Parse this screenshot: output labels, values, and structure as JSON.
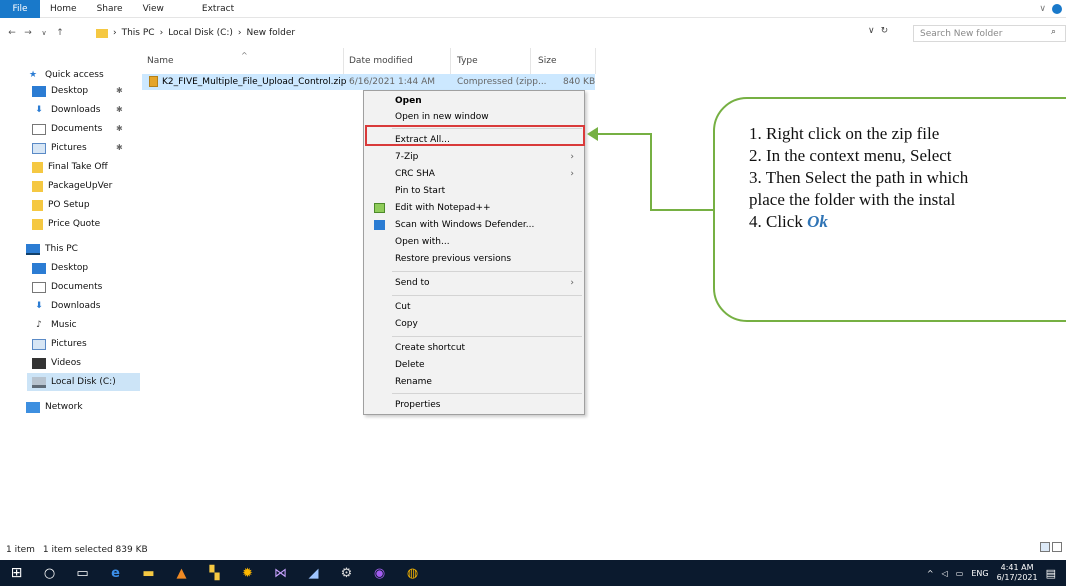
{
  "ribbon": {
    "file": "File",
    "tabs": [
      "Home",
      "Share",
      "View"
    ],
    "extract_tab": "Extract"
  },
  "address": {
    "crumbs": [
      "This PC",
      "Local Disk (C:)",
      "New folder"
    ],
    "search_placeholder": "Search New folder"
  },
  "sidebar": {
    "quick_access": "Quick access",
    "quick_items": [
      "Desktop",
      "Downloads",
      "Documents",
      "Pictures",
      "Final Take Off",
      "PackageUpVer",
      "PO Setup",
      "Price Quote"
    ],
    "this_pc": "This PC",
    "pc_items": [
      "Desktop",
      "Documents",
      "Downloads",
      "Music",
      "Pictures",
      "Videos",
      "Local Disk (C:)"
    ],
    "network": "Network"
  },
  "columns": {
    "name": "Name",
    "date": "Date modified",
    "type": "Type",
    "size": "Size"
  },
  "file": {
    "name": "K2_FIVE_Multiple_File_Upload_Control.zip",
    "date": "6/16/2021 1:44 AM",
    "type": "Compressed (zipp...",
    "size": "840 KB"
  },
  "context_menu": {
    "open": "Open",
    "open_new_window": "Open in new window",
    "extract_all": "Extract All...",
    "seven_zip": "7-Zip",
    "crc_sha": "CRC SHA",
    "pin_start": "Pin to Start",
    "edit_notepad": "Edit with Notepad++",
    "scan_defender": "Scan with Windows Defender...",
    "open_with": "Open with...",
    "restore_versions": "Restore previous versions",
    "send_to": "Send to",
    "cut": "Cut",
    "copy": "Copy",
    "create_shortcut": "Create shortcut",
    "delete": "Delete",
    "rename": "Rename",
    "properties": "Properties"
  },
  "callout": {
    "line1": "1. Right click on the zip file",
    "line2": "2. In the context menu, Select",
    "line3": "3. Then Select the path in which",
    "line4": "place the folder with the instal",
    "line5_prefix": "4. Click ",
    "line5_ok": "Ok"
  },
  "status": {
    "count": "1 item",
    "selected": "1 item selected  839 KB"
  },
  "tray": {
    "lang": "ENG",
    "time": "4:41 AM",
    "date": "6/17/2021"
  },
  "colors": {
    "accent": "#1979ca",
    "selection": "#cce8ff",
    "highlight_box": "#d93a3a",
    "callout_green": "#76b043",
    "taskbar": "#0b1a2e"
  }
}
